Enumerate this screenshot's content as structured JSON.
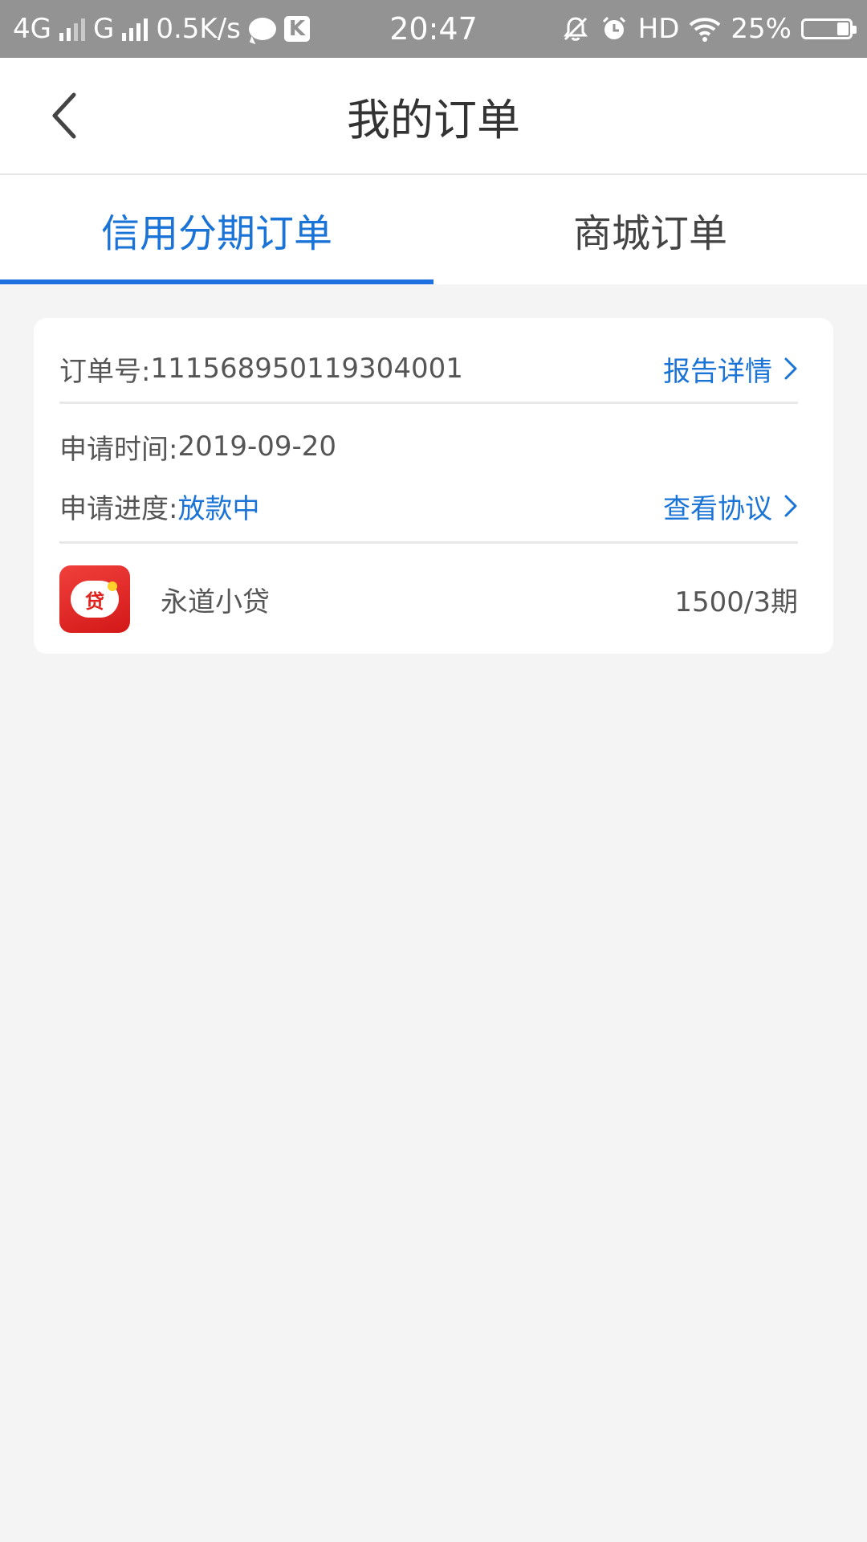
{
  "status_bar": {
    "network1": "4G",
    "network2": "G",
    "speed": "0.5K/s",
    "time": "20:47",
    "hd": "HD",
    "battery": "25%",
    "battery_level": 0.25
  },
  "header": {
    "title": "我的订单"
  },
  "tabs": [
    {
      "label": "信用分期订单",
      "active": true
    },
    {
      "label": "商城订单",
      "active": false
    }
  ],
  "order": {
    "number_label": "订单号:",
    "number": "111568950119304001",
    "report_link": "报告详情",
    "time_label": "申请时间:",
    "time": "2019-09-20",
    "progress_label": "申请进度:",
    "progress": "放款中",
    "agreement_link": "查看协议",
    "product_logo_text": "贷",
    "product_name": "永道小贷",
    "amount": "1500/3期"
  },
  "colors": {
    "accent": "#1a73d6",
    "status_bar": "#939393",
    "background": "#f4f4f4",
    "logo_red": "#e0221e"
  }
}
